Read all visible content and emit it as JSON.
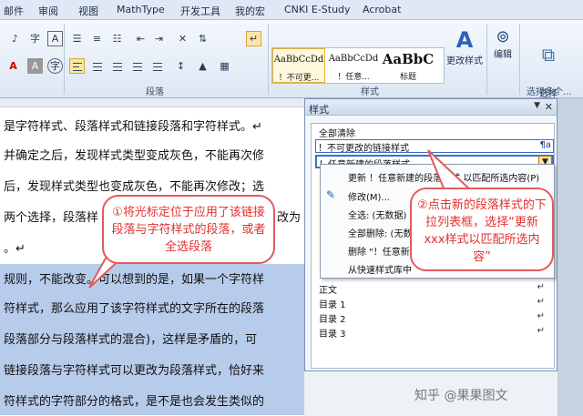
{
  "ribbon_tabs": [
    "邮件",
    "审阅",
    "视图",
    "MathType",
    "开发工具",
    "我的宏",
    "CNKI E-Study",
    "Acrobat"
  ],
  "ribbon": {
    "group_paragraph": "段落",
    "group_styles": "样式",
    "group_select": "选择多个...",
    "style_gallery": [
      {
        "preview": "AaBbCcDd",
        "name": "！不可更..."
      },
      {
        "preview": "AaBbCcDd",
        "name": "！任意..."
      },
      {
        "preview": "AaBbC",
        "name": "标题"
      }
    ],
    "change_styles": "更改样式",
    "edit": "编辑",
    "select_multiple": "选择\n多个对象",
    "font_a": "A",
    "bold_a": "A"
  },
  "document": {
    "lines": [
      "是字符样式、段落样式和链接段落和字符样式。↵",
      "并确定之后，发现样式类型变成灰色，不能再次修",
      "后，发现样式类型也变成灰色，不能再次修改；选",
      "两个选择，段落样",
      "改为",
      "。↵",
      "规则，不能改变。可以想到的是，如果一个字符样",
      "符样式，那么应用了该字符样式的文字所在的段落",
      "段落部分与段落样式的混合)，这样是矛盾的，可",
      "链接段落与字符样式可以更改为段落样式，恰好来",
      "符样式的字符部分的格式，是不是也会发生类似的"
    ]
  },
  "styles_pane": {
    "title": "样式",
    "items": [
      {
        "label": "全部清除",
        "mark": ""
      },
      {
        "label": "！不可更改的链接样式",
        "mark": "¶a"
      },
      {
        "label": "！任意新建的段落样式",
        "mark": "¶"
      },
      {
        "label": "正文",
        "mark": "↵"
      },
      {
        "label": "目录 1",
        "mark": "↵"
      },
      {
        "label": "目录 2",
        "mark": "↵"
      },
      {
        "label": "目录 3",
        "mark": "↵"
      }
    ]
  },
  "dropdown_menu": {
    "items": [
      "更新 ！任意新建的段落样式 以匹配所选内容(P)",
      "修改(M)...",
      "全选: (无数据)",
      "全部删除: (无数",
      "删除 \"！任意新",
      "从快速样式库中"
    ]
  },
  "callouts": {
    "left": "①将光标定位于应用了该链接段落与字符样式的段落，或者全选段落",
    "right": "②点击新的段落样式的下拉列表框，选择“更新 xxx样式以匹配所选内容”"
  },
  "watermark": "知乎 @果果图文"
}
